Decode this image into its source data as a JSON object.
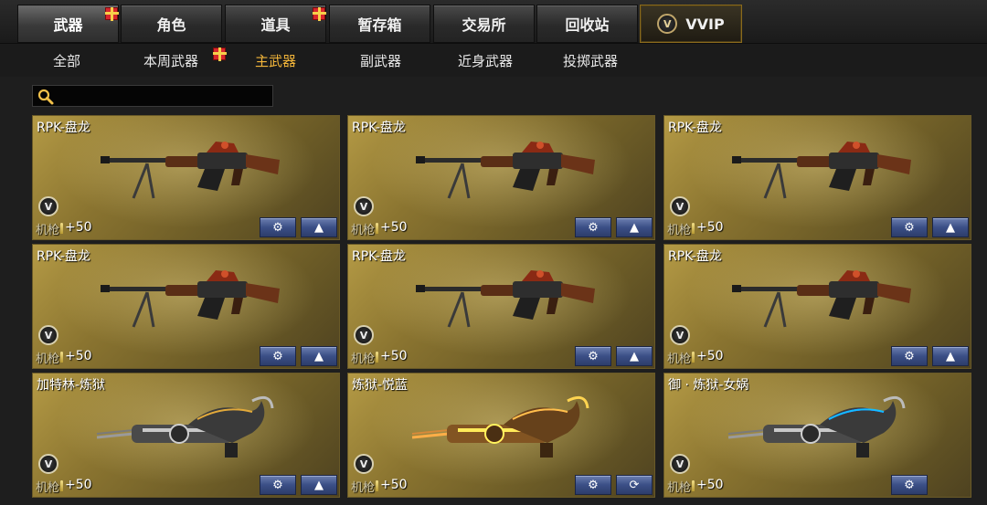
{
  "top_tabs": [
    {
      "label": "武器",
      "active": true,
      "gift": true
    },
    {
      "label": "角色",
      "active": false,
      "gift": false
    },
    {
      "label": "道具",
      "active": false,
      "gift": true
    },
    {
      "label": "暂存箱",
      "active": false,
      "gift": false
    },
    {
      "label": "交易所",
      "active": false,
      "gift": false
    },
    {
      "label": "回收站",
      "active": false,
      "gift": false
    },
    {
      "label": "VVIP",
      "active": false,
      "gift": false,
      "badge": "V"
    }
  ],
  "sub_tabs": [
    {
      "label": "全部",
      "active": false
    },
    {
      "label": "本周武器",
      "active": false,
      "gift": true
    },
    {
      "label": "主武器",
      "active": true
    },
    {
      "label": "副武器",
      "active": false
    },
    {
      "label": "近身武器",
      "active": false
    },
    {
      "label": "投掷武器",
      "active": false
    }
  ],
  "search": {
    "placeholder": "",
    "value": ""
  },
  "cards": [
    {
      "name": "RPK-盘龙",
      "type": "机枪",
      "bonus": "+50",
      "weapon": "rpk",
      "action_icon": "up-arrow-icon"
    },
    {
      "name": "RPK-盘龙",
      "type": "机枪",
      "bonus": "+50",
      "weapon": "rpk",
      "action_icon": "up-arrow-icon"
    },
    {
      "name": "RPK-盘龙",
      "type": "机枪",
      "bonus": "+50",
      "weapon": "rpk",
      "action_icon": "up-arrow-icon"
    },
    {
      "name": "RPK-盘龙",
      "type": "机枪",
      "bonus": "+50",
      "weapon": "rpk",
      "action_icon": "up-arrow-icon"
    },
    {
      "name": "RPK-盘龙",
      "type": "机枪",
      "bonus": "+50",
      "weapon": "rpk",
      "action_icon": "up-arrow-icon"
    },
    {
      "name": "RPK-盘龙",
      "type": "机枪",
      "bonus": "+50",
      "weapon": "rpk",
      "action_icon": "up-arrow-icon"
    },
    {
      "name": "加特林-炼狱",
      "type": "机枪",
      "bonus": "+50",
      "weapon": "gatling-silver",
      "action_icon": "up-arrow-icon"
    },
    {
      "name": "炼狱-悦蓝",
      "type": "机枪",
      "bonus": "+50",
      "weapon": "gatling-gold",
      "action_icon": "refresh-icon"
    },
    {
      "name": "御 · 炼狱-女娲",
      "type": "机枪",
      "bonus": "+50",
      "weapon": "gatling-blue",
      "action_icon": "none"
    }
  ],
  "colors": {
    "active_subtab": "#f2b53a",
    "card_gold": "#8a7430",
    "button_blue": "#3b4f86"
  }
}
